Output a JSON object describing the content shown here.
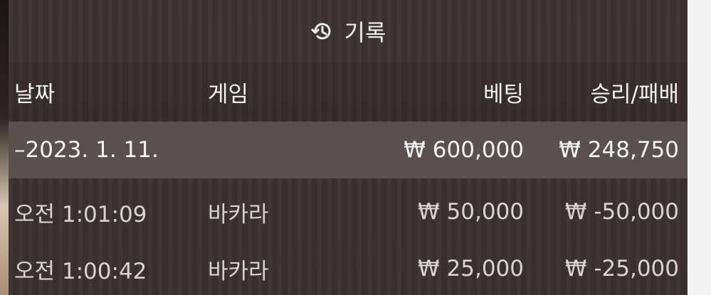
{
  "header": {
    "title": "기록",
    "icon": "history-icon"
  },
  "columns": {
    "date": "날짜",
    "game": "게임",
    "bet": "베팅",
    "result": "승리/패배"
  },
  "group": {
    "date": "–2023. 1. 11.",
    "bet": "₩ 600,000",
    "result": "₩ 248,750"
  },
  "rows": [
    {
      "time": "오전 1:01:09",
      "game": "바카라",
      "bet": "₩ 50,000",
      "result": "₩ -50,000"
    },
    {
      "time": "오전 1:00:42",
      "game": "바카라",
      "bet": "₩ 25,000",
      "result": "₩ -25,000"
    }
  ]
}
